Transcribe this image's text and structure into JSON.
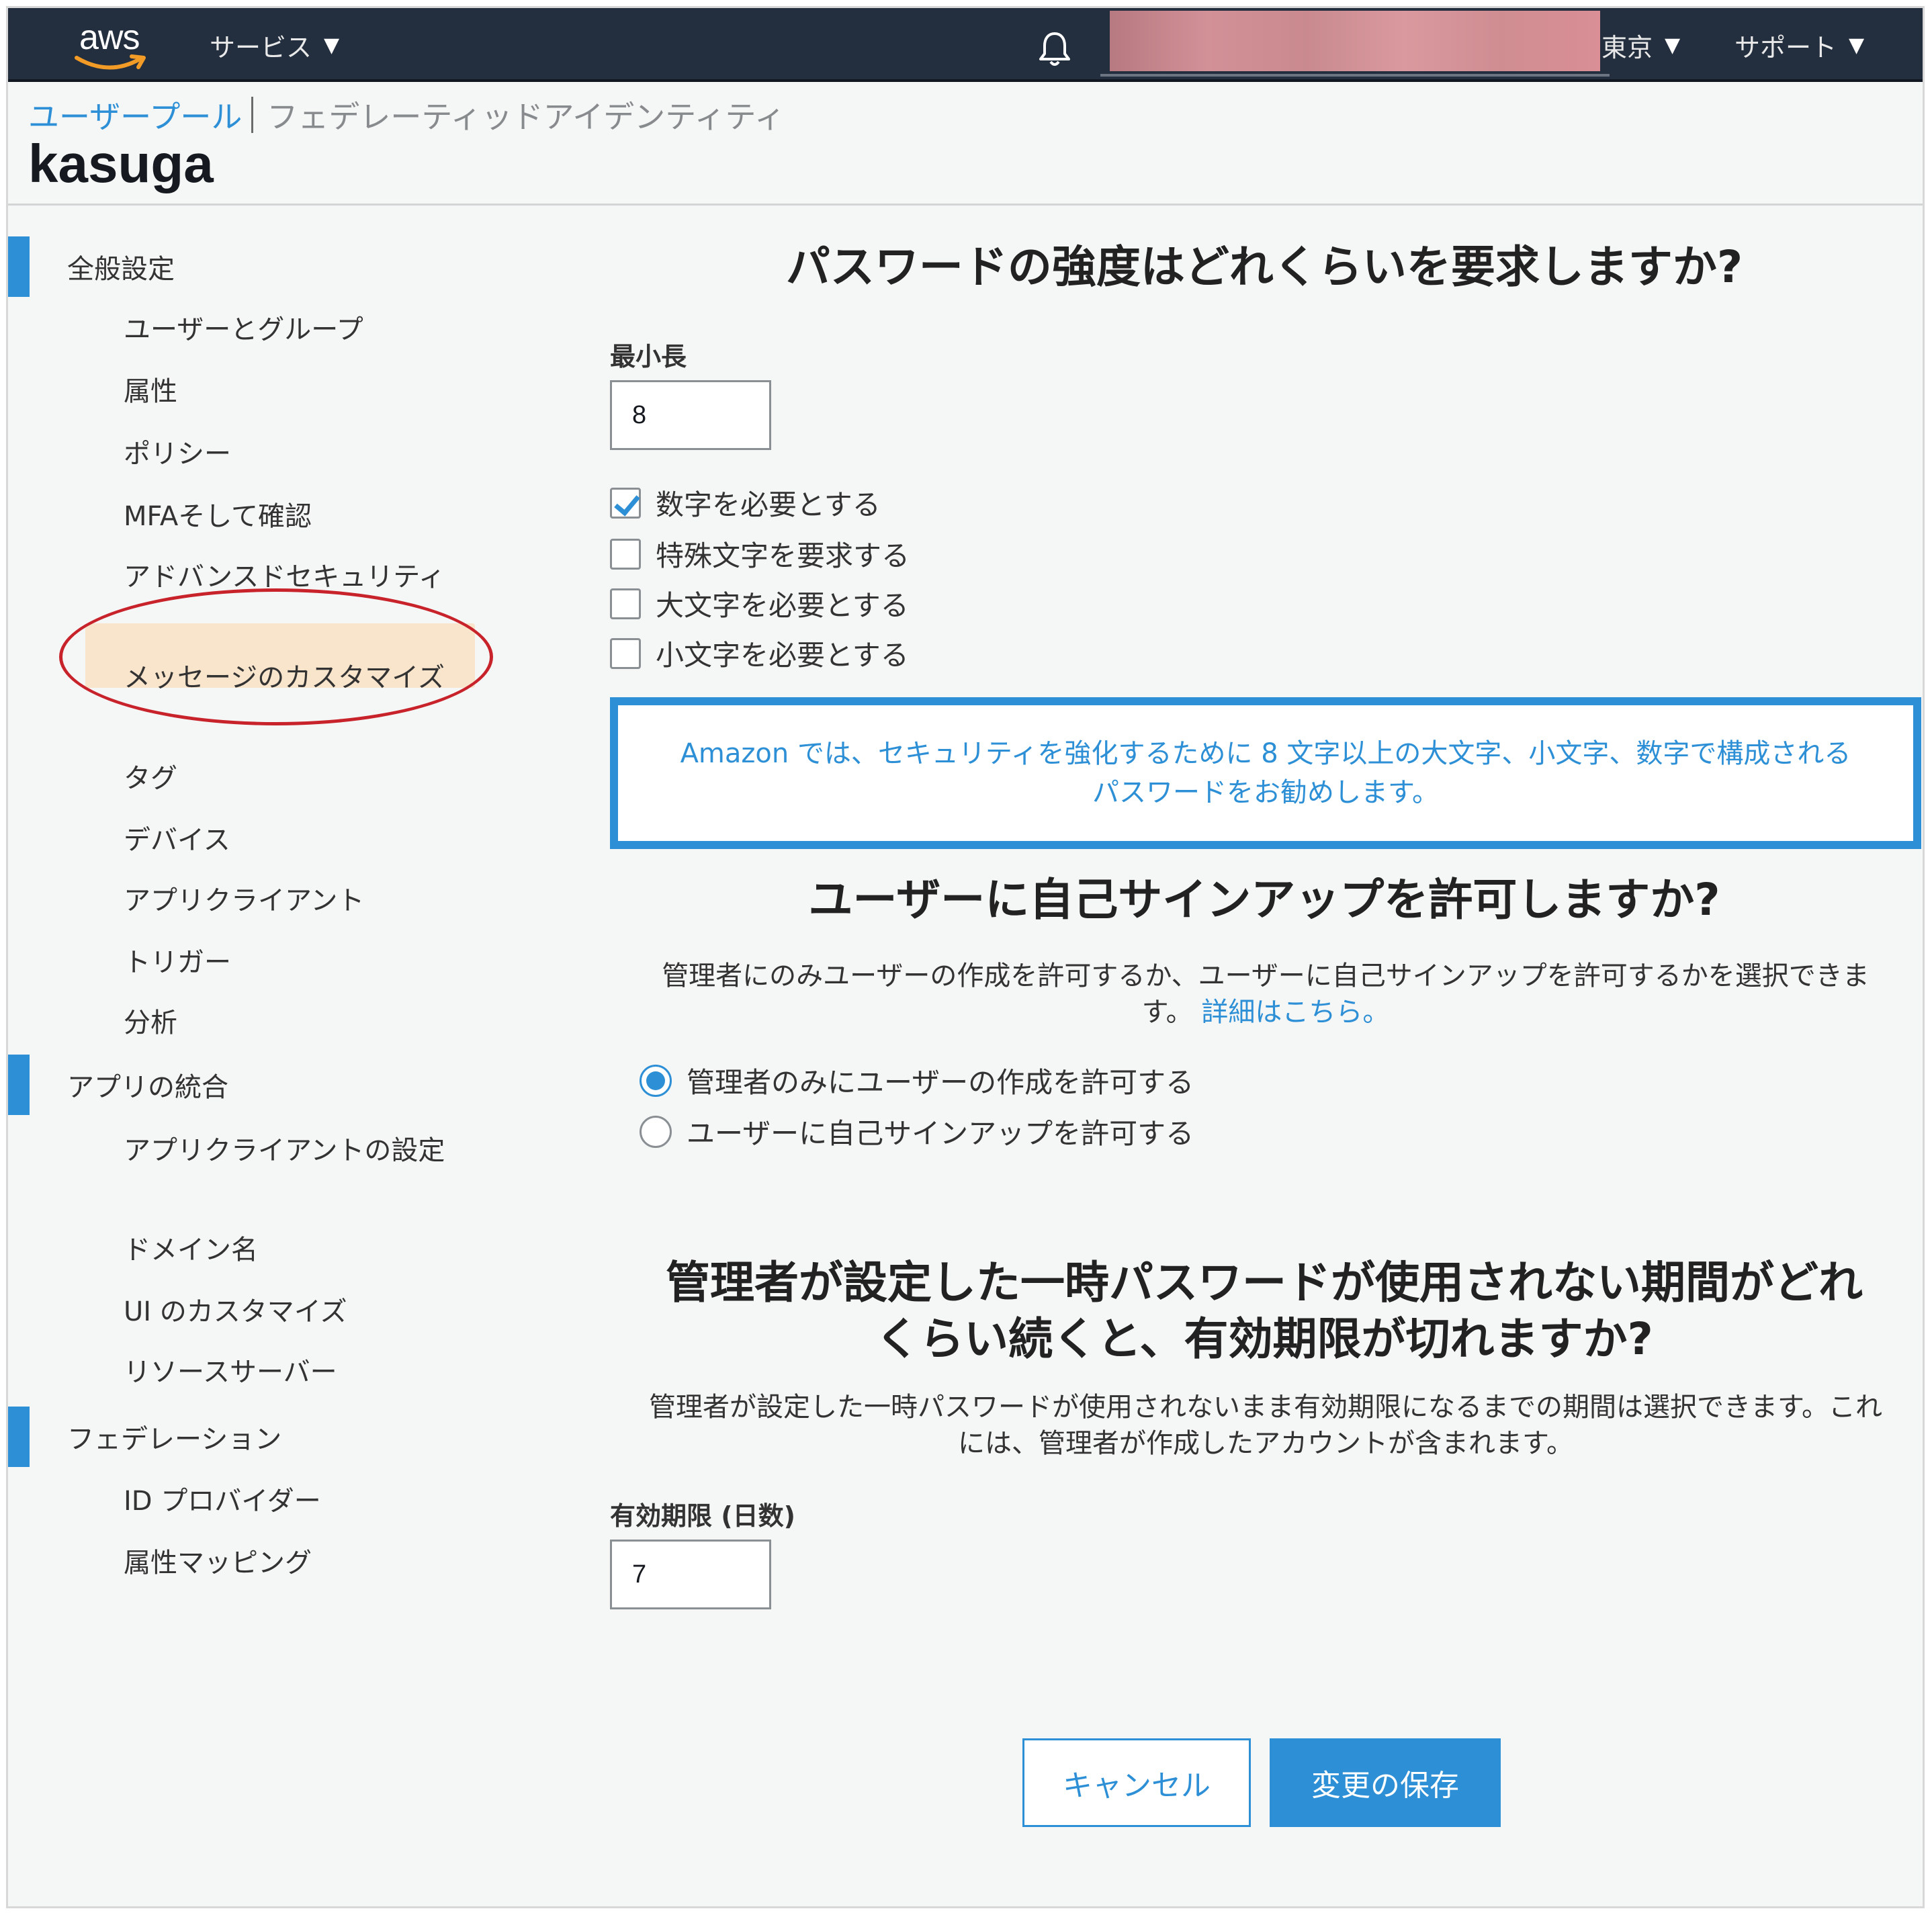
{
  "topnav": {
    "logo_text": "aws",
    "services_label": "サービス",
    "region_label": "東京",
    "support_label": "サポート"
  },
  "header": {
    "tab_active": "ユーザープール",
    "tab_inactive": "フェデレーティッドアイデンティティ",
    "pool_name": "kasuga"
  },
  "sidebar": {
    "sections": [
      {
        "label": "全般設定",
        "items": [
          "ユーザーとグループ",
          "属性",
          "ポリシー",
          "MFAそして確認",
          "アドバンスドセキュリティ",
          "メッセージのカスタマイズ",
          "タグ",
          "デバイス",
          "アプリクライアント",
          "トリガー",
          "分析"
        ]
      },
      {
        "label": "アプリの統合",
        "items": [
          "アプリクライアントの設定",
          "ドメイン名",
          "UI のカスタマイズ",
          "リソースサーバー"
        ]
      },
      {
        "label": "フェデレーション",
        "items": [
          "ID プロバイダー",
          "属性マッピング"
        ]
      }
    ],
    "active_item": "ポリシー"
  },
  "password": {
    "heading": "パスワードの強度はどれくらいを要求しますか?",
    "min_length_label": "最小長",
    "min_length_value": "8",
    "checkboxes": [
      {
        "label": "数字を必要とする",
        "checked": true
      },
      {
        "label": "特殊文字を要求する",
        "checked": false
      },
      {
        "label": "大文字を必要とする",
        "checked": false
      },
      {
        "label": "小文字を必要とする",
        "checked": false
      }
    ],
    "recommendation_line1": "Amazon では、セキュリティを強化するために 8 文字以上の大文字、小文字、数字で構成される",
    "recommendation_line2": "パスワードをお勧めします。"
  },
  "signup": {
    "heading": "ユーザーに自己サインアップを許可しますか?",
    "description_line1": "管理者にのみユーザーの作成を許可するか、ユーザーに自己サインアップを許可するかを選択できま",
    "description_line2": "す。",
    "more_link": "詳細はこちら。",
    "options": [
      {
        "label": "管理者のみにユーザーの作成を許可する",
        "selected": true
      },
      {
        "label": "ユーザーに自己サインアップを許可する",
        "selected": false
      }
    ]
  },
  "expiry": {
    "heading_line1": "管理者が設定した一時パスワードが使用されない期間がどれ",
    "heading_line2": "くらい続くと、有効期限が切れますか?",
    "description_line1": "管理者が設定した一時パスワードが使用されないまま有効期限になるまでの期間は選択できます。これ",
    "description_line2": "には、管理者が作成したアカウントが含まれます。",
    "days_label": "有効期限 (日数)",
    "days_value": "7"
  },
  "actions": {
    "cancel_label": "キャンセル",
    "save_label": "変更の保存"
  },
  "colors": {
    "accent": "#2d8fd5",
    "nav_bg": "#232f3e",
    "active_item_bg": "#f9e4cc",
    "annotation_ring": "#c8232b",
    "redaction": "#d29097"
  }
}
